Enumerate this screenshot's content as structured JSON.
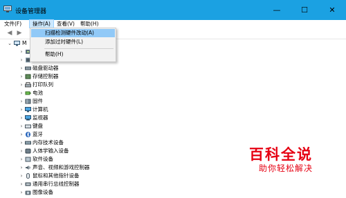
{
  "window": {
    "title": "设备管理器",
    "controls": {
      "minimize": "—",
      "maximize": "☐",
      "close": "✕"
    }
  },
  "menubar": {
    "items": [
      "文件(F)",
      "操作(A)",
      "查看(V)",
      "帮助(H)"
    ],
    "active_index": 1
  },
  "dropdown": {
    "items": [
      "扫描检测硬件改动(A)",
      "添加过时硬件(L)",
      "帮助(H)"
    ],
    "highlighted_index": 0
  },
  "tree": {
    "root_label": "M",
    "categories": [
      {
        "label": "",
        "icon": "audio-io-icon"
      },
      {
        "label": "处理器",
        "icon": "processor-icon"
      },
      {
        "label": "磁盘驱动器",
        "icon": "disk-drive-icon"
      },
      {
        "label": "存储控制器",
        "icon": "storage-controller-icon"
      },
      {
        "label": "打印队列",
        "icon": "print-queue-icon"
      },
      {
        "label": "电池",
        "icon": "battery-icon"
      },
      {
        "label": "固件",
        "icon": "firmware-icon"
      },
      {
        "label": "计算机",
        "icon": "computer-icon"
      },
      {
        "label": "监视器",
        "icon": "monitor-icon"
      },
      {
        "label": "键盘",
        "icon": "keyboard-icon"
      },
      {
        "label": "蓝牙",
        "icon": "bluetooth-icon"
      },
      {
        "label": "内存技术设备",
        "icon": "memory-device-icon"
      },
      {
        "label": "人体学输入设备",
        "icon": "hid-icon"
      },
      {
        "label": "软件设备",
        "icon": "software-device-icon"
      },
      {
        "label": "声音、视频和游戏控制器",
        "icon": "sound-icon"
      },
      {
        "label": "鼠标和其他指针设备",
        "icon": "mouse-icon"
      },
      {
        "label": "通用串行总线控制器",
        "icon": "usb-icon"
      },
      {
        "label": "图像设备",
        "icon": "imaging-device-icon"
      }
    ]
  },
  "watermark": {
    "title": "百科全说",
    "subtitle": "助你轻松解决"
  },
  "colors": {
    "titlebar": "#1ba1e2",
    "menu_highlight": "#91c9f7",
    "watermark": "#e60012"
  }
}
